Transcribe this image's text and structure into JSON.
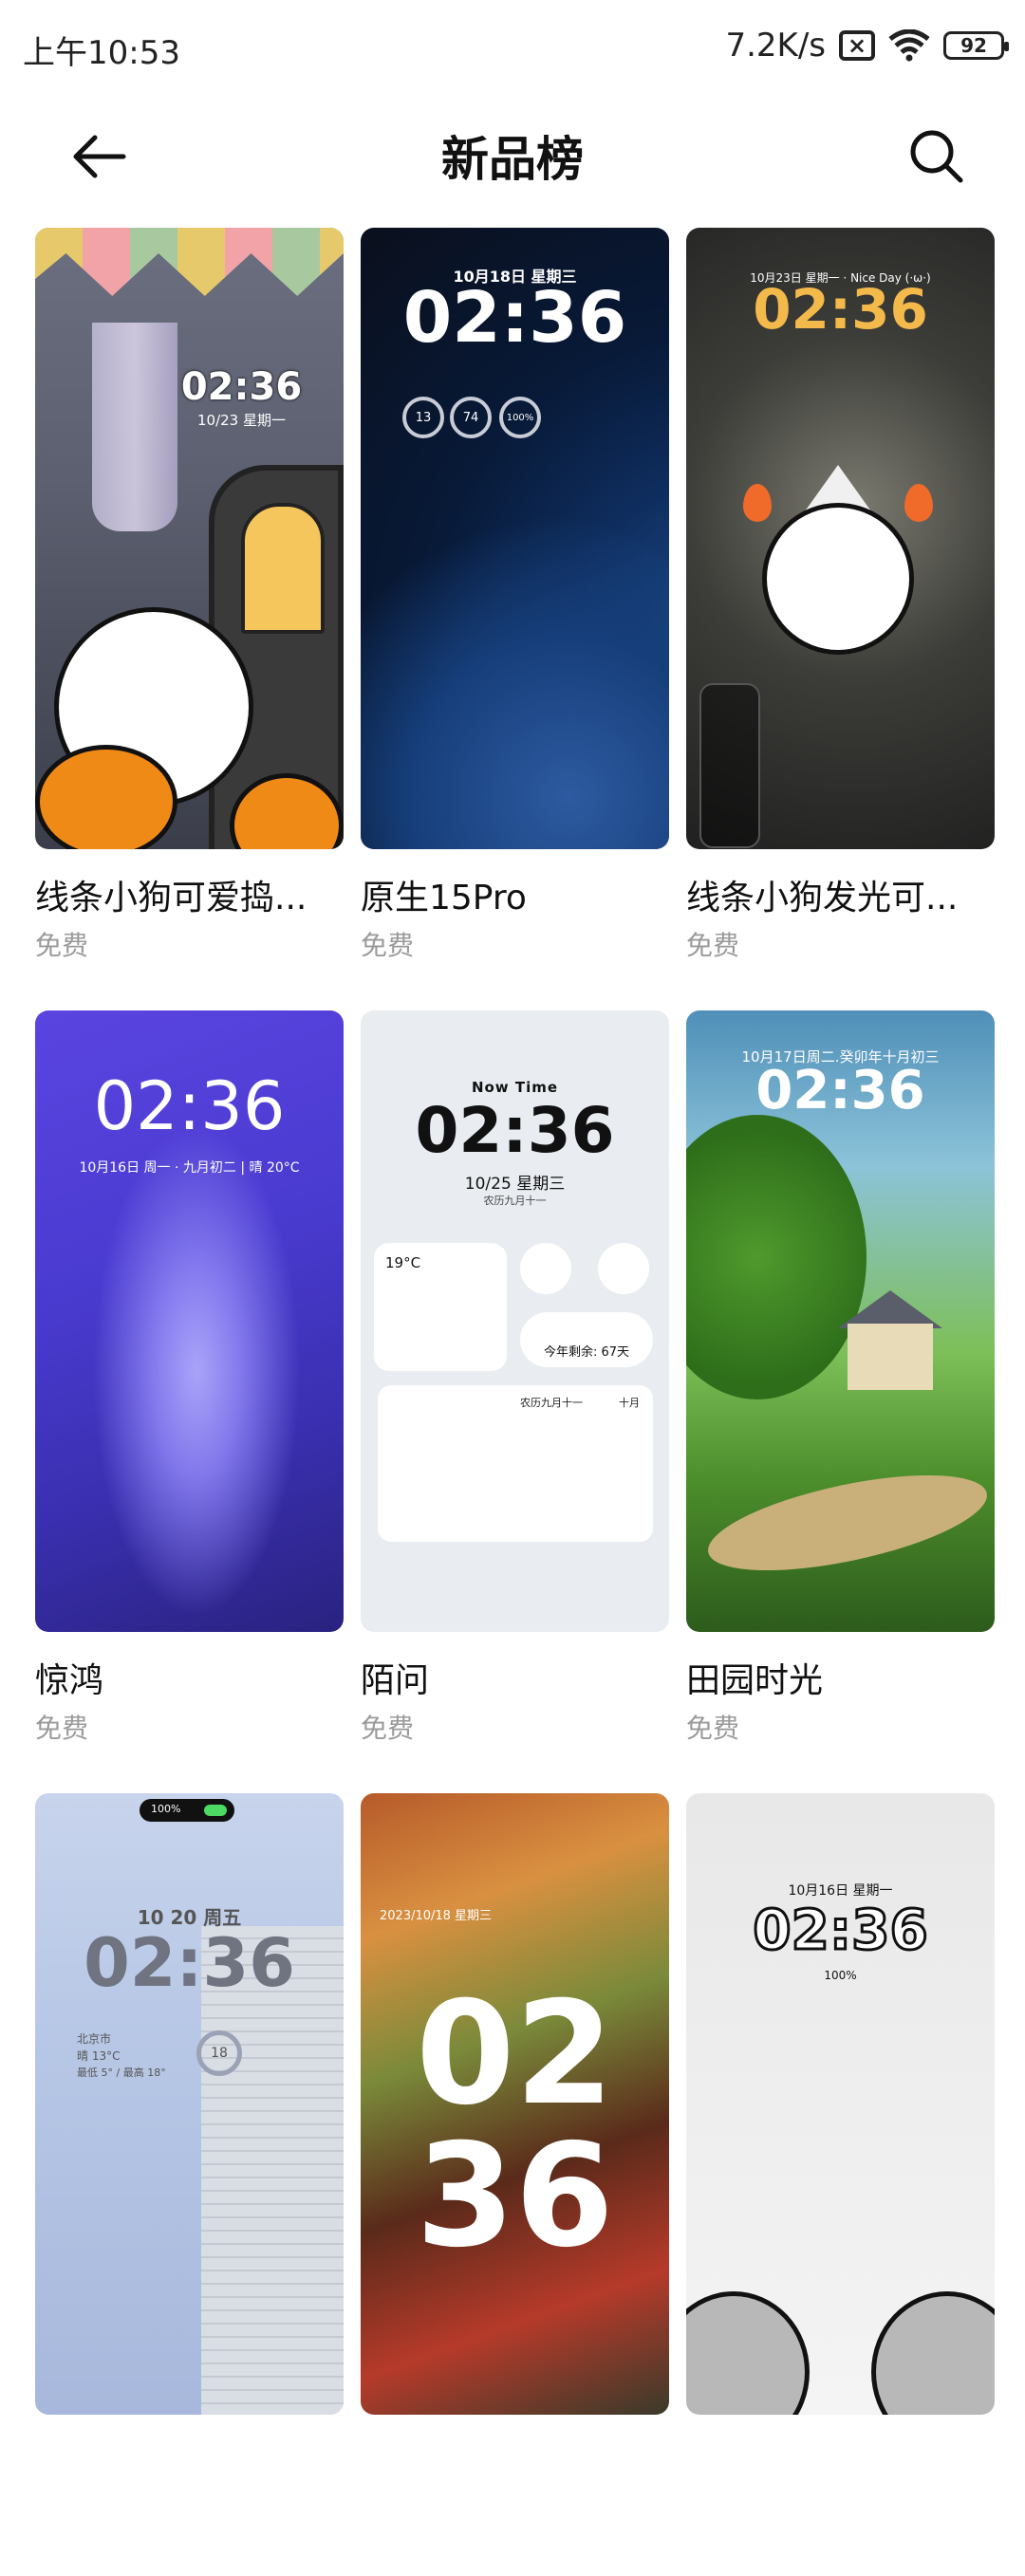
{
  "status_bar": {
    "time": "上午10:53",
    "speed": "7.2K/s",
    "battery": "92"
  },
  "header": {
    "title": "新品榜"
  },
  "items": [
    {
      "name": "线条小狗可爱捣...",
      "price": "免费",
      "preview": {
        "time": "02:36",
        "date": "10/23 星期一"
      }
    },
    {
      "name": "原生15Pro",
      "price": "免费",
      "preview": {
        "time": "02:36",
        "date": "10月18日 星期三",
        "rings": [
          "13",
          "74",
          "100%"
        ]
      }
    },
    {
      "name": "线条小狗发光可...",
      "price": "免费",
      "preview": {
        "time": "02:36",
        "date": "10月23日 星期一 · Nice Day (·ω·)"
      }
    },
    {
      "name": "惊鸿",
      "price": "免费",
      "preview": {
        "time": "02:36",
        "date": "10月16日 周一 · 九月初二 | 晴 20°C"
      }
    },
    {
      "name": "陌问",
      "price": "免费",
      "preview": {
        "heading": "Now Time",
        "time": "02:36",
        "date": "10/25 星期三",
        "lunar": "农历九月十一",
        "temp": "19°C",
        "countdown": "今年剩余: 67天",
        "cal_title": "农历九月十一",
        "cal_month": "十月"
      }
    },
    {
      "name": "田园时光",
      "price": "免费",
      "preview": {
        "time": "02:36",
        "date": "10月17日周二.癸卯年十月初三"
      }
    },
    {
      "name": "",
      "price": "",
      "preview": {
        "time": "02:36",
        "date": "10 20  周五",
        "city": "北京市",
        "weather": "晴 13°C",
        "minmax": "最低 5° / 最高 18°",
        "aqi": "18",
        "batt": "100%"
      }
    },
    {
      "name": "",
      "price": "",
      "preview": {
        "time1": "02",
        "time2": "36",
        "date": "2023/10/18 星期三"
      }
    },
    {
      "name": "",
      "price": "",
      "preview": {
        "time": "02:36",
        "date": "10月16日 星期一",
        "batt": "100%"
      }
    }
  ]
}
